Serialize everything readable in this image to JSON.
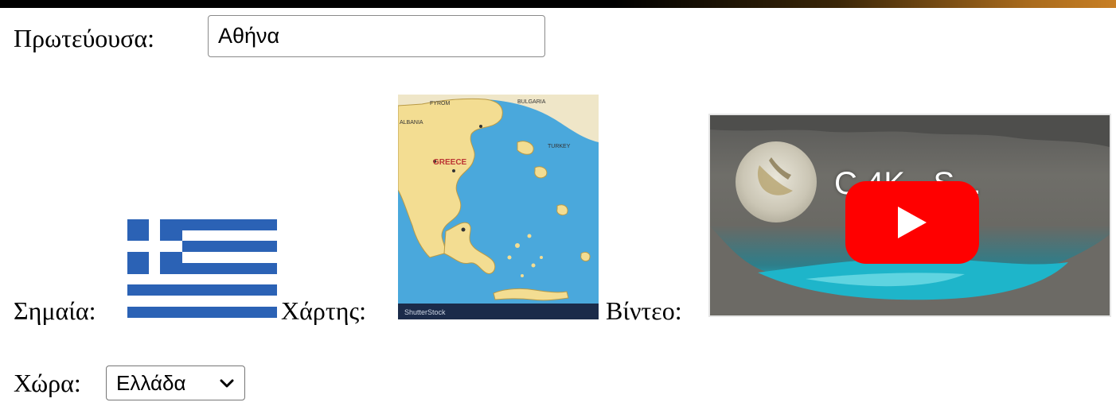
{
  "form": {
    "capital_label": "Πρωτεύουσα:",
    "capital_value": "Αθήνα",
    "flag_label": "Σημαία:",
    "map_label": "Χάρτης:",
    "video_label": "Βίντεο:",
    "country_label": "Χώρα:",
    "country_selected": "Ελλάδα"
  },
  "map_image": {
    "country_name": "GREECE",
    "brand": "ShutterStock"
  },
  "video": {
    "title_visible": "C           4K - S..."
  },
  "colors": {
    "flag_blue": "#2b62b5",
    "youtube_red": "#ff0000",
    "sea_blue": "#4aa8dc",
    "land_yellow": "#f3dd92"
  },
  "icons": {
    "play": "play-icon",
    "dropdown": "chevron-down-icon"
  }
}
